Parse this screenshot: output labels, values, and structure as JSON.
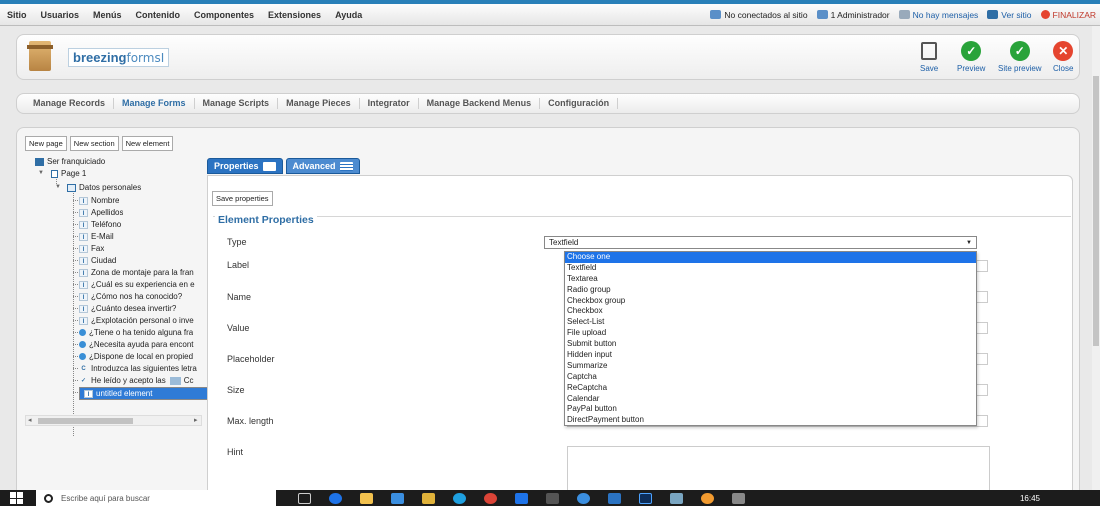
{
  "topbar": {
    "menu": [
      "Sitio",
      "Usuarios",
      "Menús",
      "Contenido",
      "Componentes",
      "Extensiones",
      "Ayuda"
    ],
    "status": [
      {
        "text": "No conectados al sitio",
        "color": "#5a8fc8"
      },
      {
        "text": "1 Administrador",
        "color": "#5a8fc8"
      },
      {
        "text": "No hay mensajes",
        "color": "#9ab"
      },
      {
        "text": "Ver sitio",
        "color": "#2f6ea5"
      },
      {
        "text": "FINALIZAR",
        "color": "#e5452f"
      }
    ]
  },
  "header": {
    "logo_bold": "breezing",
    "logo_light": "forms",
    "toolbar": {
      "save": "Save",
      "preview": "Preview",
      "site_preview": "Site preview",
      "close": "Close"
    }
  },
  "nav": [
    "Manage Records",
    "Manage Forms",
    "Manage Scripts",
    "Manage Pieces",
    "Integrator",
    "Manage Backend Menus",
    "Configuración"
  ],
  "buttons": {
    "new_page": "New page",
    "new_section": "New section",
    "new_element": "New element"
  },
  "tree": {
    "root": "Ser franquiciado",
    "page": "Page 1",
    "section": "Datos personales",
    "items": [
      {
        "label": "Nombre",
        "icon": "text-icon"
      },
      {
        "label": "Apellidos",
        "icon": "text-icon"
      },
      {
        "label": "Teléfono",
        "icon": "text-icon"
      },
      {
        "label": "E-Mail",
        "icon": "text-icon"
      },
      {
        "label": "Fax",
        "icon": "text-icon"
      },
      {
        "label": "Ciudad",
        "icon": "text-icon"
      },
      {
        "label": "Zona de montaje para la fran",
        "icon": "text-icon"
      },
      {
        "label": "¿Cuál es su experiencia en e",
        "icon": "text-icon"
      },
      {
        "label": "¿Cómo nos ha conocido?",
        "icon": "text-icon"
      },
      {
        "label": "¿Cuánto desea invertir?",
        "icon": "text-icon"
      },
      {
        "label": "¿Explotación personal o inve",
        "icon": "text-icon"
      },
      {
        "label": "¿Tiene o ha tenido alguna fra",
        "icon": "radio-icon"
      },
      {
        "label": "¿Necesita ayuda para encont",
        "icon": "radio-icon"
      },
      {
        "label": "¿Dispone de local en propied",
        "icon": "radio-icon"
      },
      {
        "label": "Introduzca las siguientes letra",
        "icon": "captcha-icon"
      },
      {
        "label": "He leído y acepto las",
        "icon": "checkbox-icon",
        "suffix": "Cc"
      },
      {
        "label": "untitled element",
        "icon": "text-icon",
        "selected": true
      }
    ]
  },
  "tabs": {
    "properties": "Properties",
    "advanced": "Advanced"
  },
  "props": {
    "save_button": "Save properties",
    "legend": "Element Properties",
    "labels": {
      "type": "Type",
      "label": "Label",
      "name": "Name",
      "value": "Value",
      "placeholder": "Placeholder",
      "size": "Size",
      "max_length": "Max. length",
      "hint": "Hint"
    }
  },
  "type_select": {
    "selected": "Textfield",
    "options": [
      "Choose one",
      "Textfield",
      "Textarea",
      "Radio group",
      "Checkbox group",
      "Checkbox",
      "Select-List",
      "File upload",
      "Submit button",
      "Hidden input",
      "Summarize",
      "Captcha",
      "ReCaptcha",
      "Calendar",
      "PayPal button",
      "DirectPayment button"
    ],
    "highlighted": "Choose one"
  },
  "taskbar": {
    "search_placeholder": "Escribe aquí para buscar",
    "clock": "16:45"
  },
  "colors": {
    "accent": "#2f6ea5",
    "tab": "#2b73c2",
    "highlight": "#1e73e8",
    "green": "#29a33a",
    "red": "#e5452f"
  }
}
